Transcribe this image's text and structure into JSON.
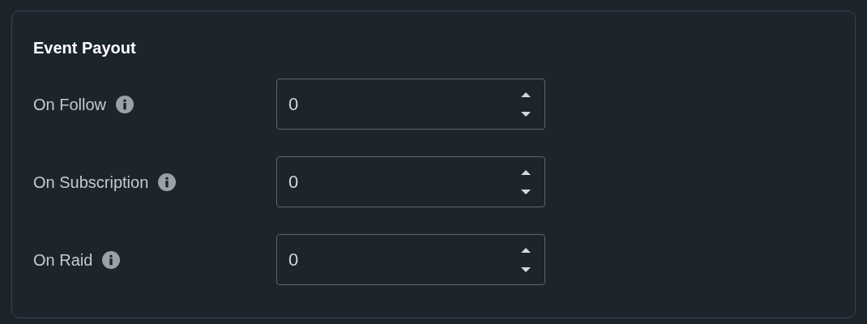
{
  "card": {
    "title": "Event Payout",
    "fields": [
      {
        "label": "On Follow",
        "value": "0"
      },
      {
        "label": "On Subscription",
        "value": "0"
      },
      {
        "label": "On Raid",
        "value": "0"
      }
    ]
  }
}
